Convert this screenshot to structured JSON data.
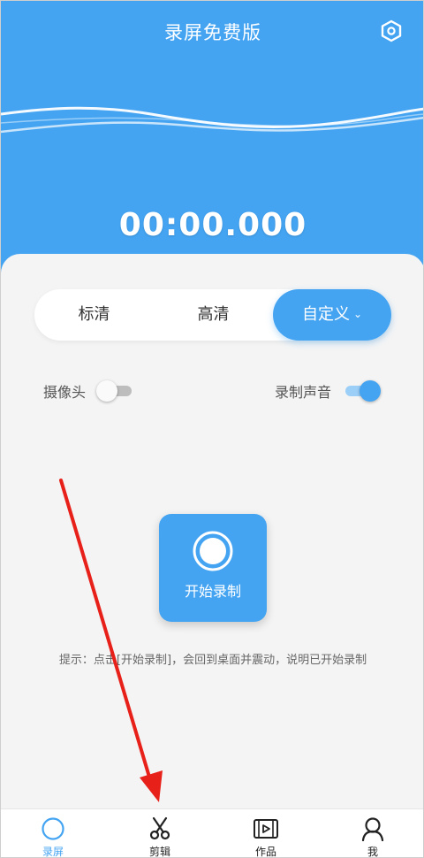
{
  "app_title": "录屏免费版",
  "timer": "00:00.000",
  "quality": {
    "options": [
      "标清",
      "高清",
      "自定义"
    ],
    "selected": "自定义"
  },
  "toggles": {
    "camera": {
      "label": "摄像头",
      "on": false
    },
    "audio": {
      "label": "录制声音",
      "on": true
    }
  },
  "record_button": {
    "label": "开始录制"
  },
  "hint": "提示：点击[开始录制]，会回到桌面并震动，说明已开始录制",
  "nav": [
    {
      "label": "录屏",
      "icon": "record-circle-icon",
      "active": true
    },
    {
      "label": "剪辑",
      "icon": "scissors-icon",
      "active": false
    },
    {
      "label": "作品",
      "icon": "video-film-icon",
      "active": false
    },
    {
      "label": "我",
      "icon": "user-icon",
      "active": false
    }
  ],
  "colors": {
    "primary": "#44a4f2",
    "background": "#f4f4f4",
    "annotation": "#e8201a"
  }
}
